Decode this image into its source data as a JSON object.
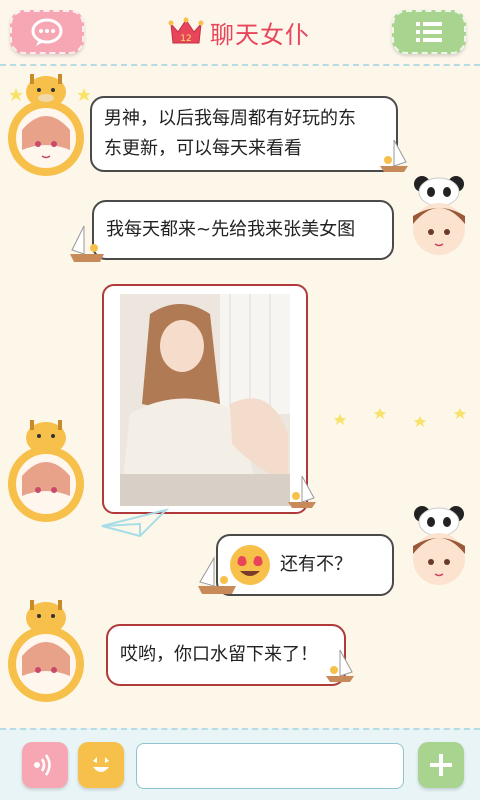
{
  "header": {
    "title": "聊天女仆",
    "crown_badge": "12",
    "left_icon": "chat-bubble-icon",
    "right_icon": "menu-icon"
  },
  "messages": [
    {
      "side": "left",
      "speaker": "maid",
      "text_line1": "男神，以后我每周都有好玩的东",
      "text_line2": "东更新，可以每天来看看"
    },
    {
      "side": "right",
      "speaker": "user",
      "text": "我每天都来~先给我来张美女图"
    },
    {
      "side": "left",
      "speaker": "maid",
      "type": "image"
    },
    {
      "side": "right",
      "speaker": "user",
      "emoji": "heart-eyes-emoji",
      "text": "还有不？"
    },
    {
      "side": "left",
      "speaker": "maid",
      "text": "哎哟，你口水留下来了！"
    }
  ],
  "footer": {
    "voice_icon": "voice-icon",
    "emoji_icon": "smiley-icon",
    "input_value": "",
    "input_placeholder": "",
    "add_icon": "plus-icon"
  },
  "colors": {
    "background": "#fdf7e9",
    "title": "#e8455b",
    "left_button": "#f6a7b3",
    "right_button": "#a8d48f",
    "voice_button": "#f6a7b3",
    "emoji_button": "#f7c04a",
    "add_button": "#a8d48f"
  }
}
